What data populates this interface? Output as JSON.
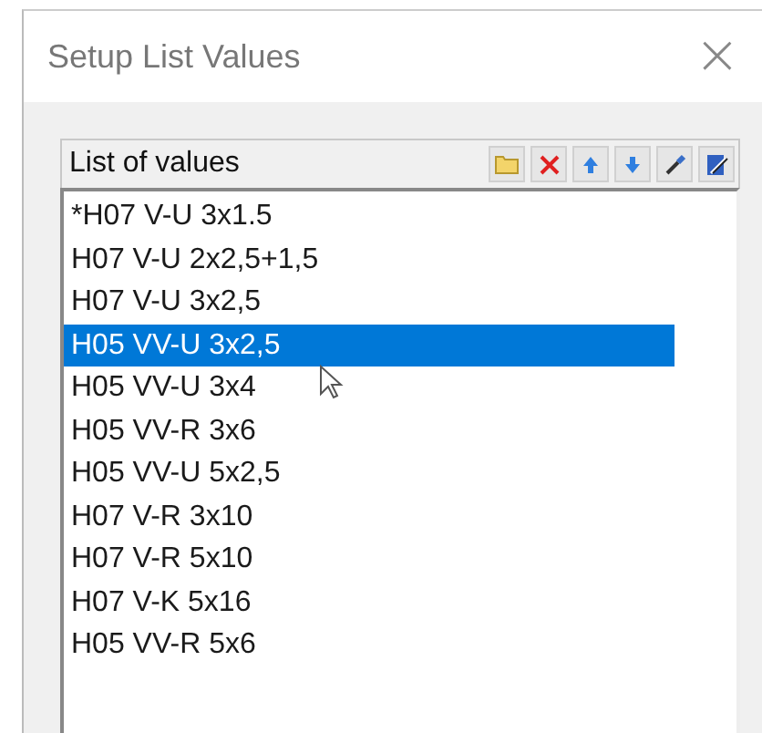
{
  "window": {
    "title": "Setup List Values",
    "close": "×"
  },
  "list": {
    "header": "List of values",
    "toolbar": [
      {
        "kind": "folder"
      },
      {
        "kind": "delete"
      },
      {
        "kind": "up"
      },
      {
        "kind": "down"
      },
      {
        "kind": "picker"
      },
      {
        "kind": "edit"
      }
    ],
    "items": [
      {
        "label": "*H07 V-U 3x1.5",
        "selected": false
      },
      {
        "label": "H07 V-U 2x2,5+1,5",
        "selected": false
      },
      {
        "label": "H07 V-U 3x2,5",
        "selected": false
      },
      {
        "label": "H05 VV-U 3x2,5",
        "selected": true
      },
      {
        "label": "H05 VV-U 3x4",
        "selected": false
      },
      {
        "label": "H05 VV-R 3x6",
        "selected": false
      },
      {
        "label": "H05 VV-U 5x2,5",
        "selected": false
      },
      {
        "label": "H07 V-R 3x10",
        "selected": false
      },
      {
        "label": "H07 V-R 5x10",
        "selected": false
      },
      {
        "label": "H07 V-K 5x16",
        "selected": false
      },
      {
        "label": "H05 VV-R 5x6",
        "selected": false
      }
    ]
  }
}
